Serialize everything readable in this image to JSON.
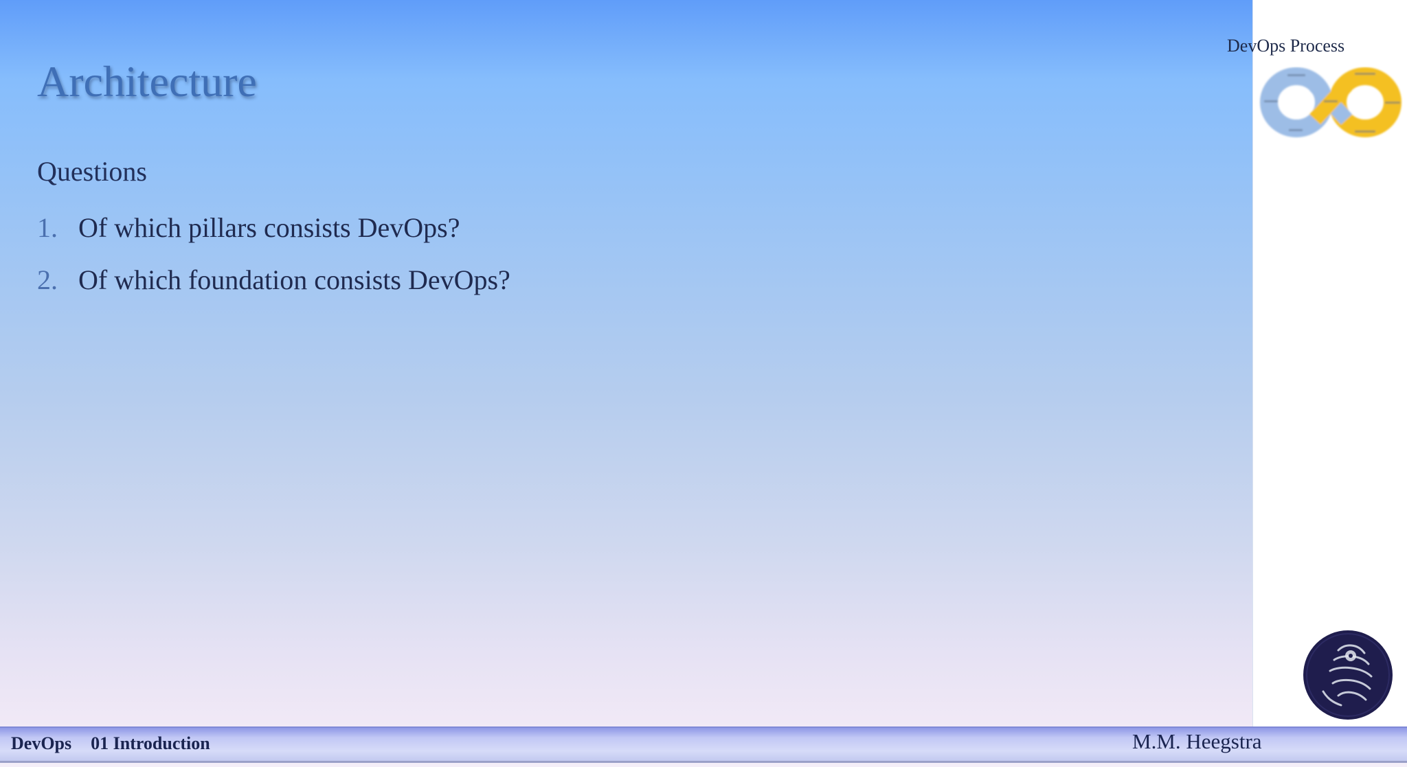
{
  "slide": {
    "title": "Architecture",
    "subtitle": "Questions",
    "questions": [
      {
        "number": "1.",
        "text": "Of which pillars consists DevOps?"
      },
      {
        "number": "2.",
        "text": "Of which foundation consists DevOps?"
      }
    ]
  },
  "side_panel": {
    "process_label": "DevOps Process",
    "process_image": "devops-infinity-loop-icon",
    "logo_image": "dark-circular-seal-logo"
  },
  "footer": {
    "course": "DevOps",
    "chapter": "01 Introduction",
    "author": "M.M. Heegstra"
  },
  "colors": {
    "title": "#3f6fb6",
    "text": "#1f2a4f",
    "loop_blue": "#9dbde6",
    "loop_yellow": "#f4c021",
    "seal": "#1f1d4d",
    "footer": "#c2c8f5"
  }
}
